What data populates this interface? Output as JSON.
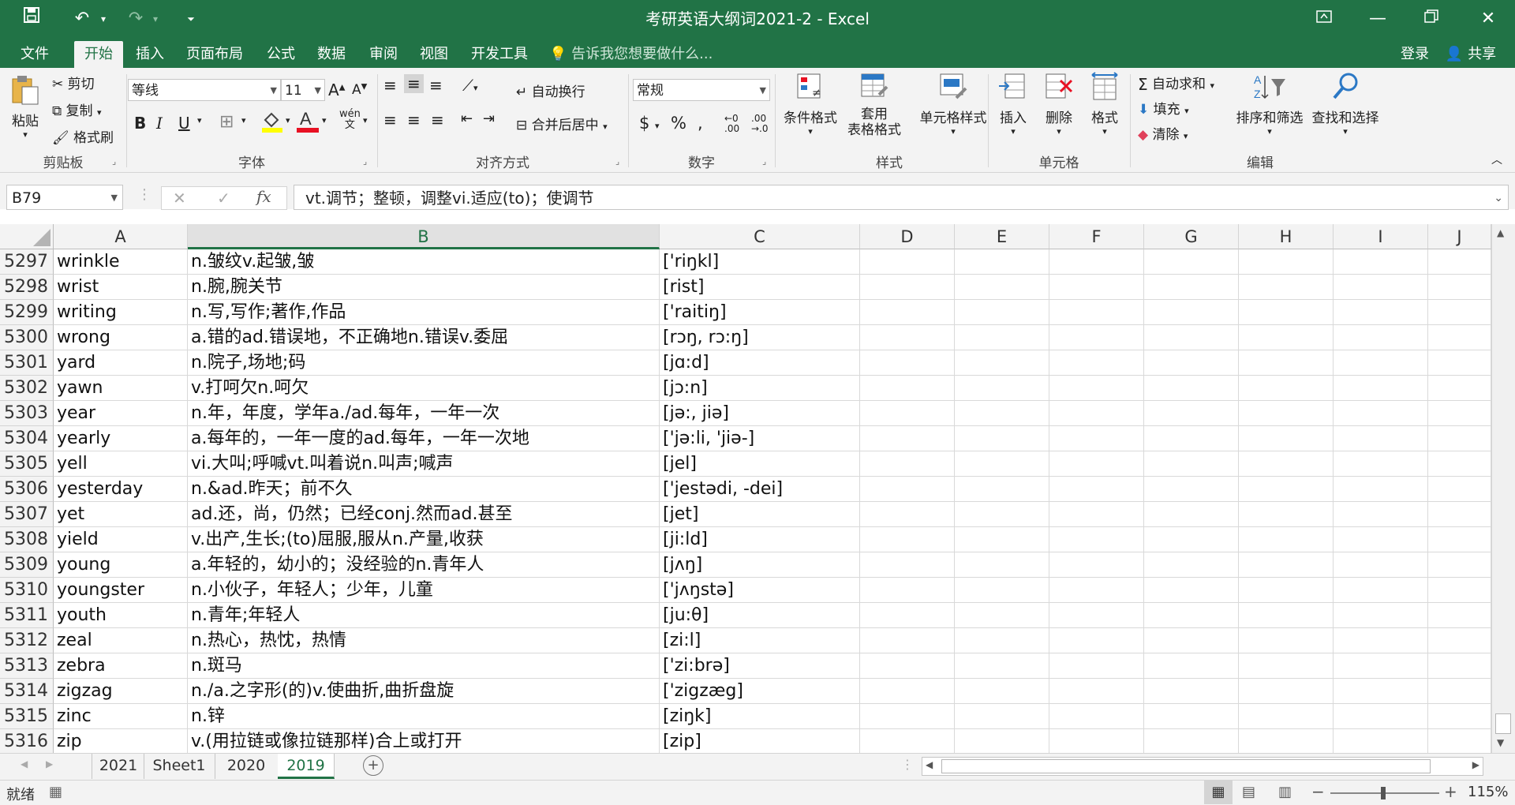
{
  "window": {
    "title": "考研英语大纲词2021-2 - Excel"
  },
  "tabs": [
    "文件",
    "开始",
    "插入",
    "页面布局",
    "公式",
    "数据",
    "审阅",
    "视图",
    "开发工具"
  ],
  "tell_me": "告诉我您想要做什么...",
  "account": {
    "login": "登录",
    "share": "共享"
  },
  "ribbon": {
    "clipboard": {
      "paste": "粘贴",
      "cut": "剪切",
      "copy": "复制",
      "format_painter": "格式刷",
      "label": "剪贴板"
    },
    "font": {
      "name": "等线",
      "size": "11",
      "label": "字体"
    },
    "alignment": {
      "wrap": "自动换行",
      "merge": "合并后居中",
      "label": "对齐方式"
    },
    "number": {
      "format": "常规",
      "label": "数字"
    },
    "styles": {
      "conditional": "条件格式",
      "table1": "套用",
      "table2": "表格格式",
      "cell_styles": "单元格样式",
      "label": "样式"
    },
    "cells": {
      "insert": "插入",
      "delete": "删除",
      "format": "格式",
      "label": "单元格"
    },
    "editing": {
      "autosum": "自动求和",
      "fill": "填充",
      "clear": "清除",
      "sort": "排序和筛选",
      "find": "查找和选择",
      "label": "编辑"
    }
  },
  "formula_bar": {
    "name_box": "B79",
    "formula": "vt.调节；整顿，调整vi.适应(to)；使调节"
  },
  "columns": [
    "A",
    "B",
    "C",
    "D",
    "E",
    "F",
    "G",
    "H",
    "I",
    "J"
  ],
  "rows": [
    {
      "n": "5297",
      "a": "wrinkle",
      "b": "n.皱纹v.起皱,皱",
      "c": "['riŋkl]"
    },
    {
      "n": "5298",
      "a": "wrist",
      "b": "n.腕,腕关节",
      "c": "[rist]"
    },
    {
      "n": "5299",
      "a": "writing",
      "b": "n.写,写作;著作,作品",
      "c": "['raitiŋ]"
    },
    {
      "n": "5300",
      "a": "wrong",
      "b": "a.错的ad.错误地，不正确地n.错误v.委屈",
      "c": "[rɔŋ, rɔ:ŋ]"
    },
    {
      "n": "5301",
      "a": "yard",
      "b": "n.院子,场地;码",
      "c": "[jɑ:d]"
    },
    {
      "n": "5302",
      "a": "yawn",
      "b": "v.打呵欠n.呵欠",
      "c": "[jɔ:n]"
    },
    {
      "n": "5303",
      "a": "year",
      "b": "n.年，年度，学年a./ad.每年，一年一次",
      "c": "[jə:, jiə]"
    },
    {
      "n": "5304",
      "a": "yearly",
      "b": "a.每年的，一年一度的ad.每年，一年一次地",
      "c": "['jə:li, 'jiə-]"
    },
    {
      "n": "5305",
      "a": "yell",
      "b": "vi.大叫;呼喊vt.叫着说n.叫声;喊声",
      "c": "[jel]"
    },
    {
      "n": "5306",
      "a": "yesterday",
      "b": "n.&ad.昨天；前不久",
      "c": "['jestədi, -dei]"
    },
    {
      "n": "5307",
      "a": "yet",
      "b": "ad.还，尚，仍然；已经conj.然而ad.甚至",
      "c": "[jet]"
    },
    {
      "n": "5308",
      "a": "yield",
      "b": "v.出产,生长;(to)屈服,服从n.产量,收获",
      "c": "[ji:ld]"
    },
    {
      "n": "5309",
      "a": "young",
      "b": "a.年轻的，幼小的；没经验的n.青年人",
      "c": "[jʌŋ]"
    },
    {
      "n": "5310",
      "a": "youngster",
      "b": "n.小伙子，年轻人；少年，儿童",
      "c": "['jʌŋstə]"
    },
    {
      "n": "5311",
      "a": "youth",
      "b": "n.青年;年轻人",
      "c": "[ju:θ]"
    },
    {
      "n": "5312",
      "a": "zeal",
      "b": "n.热心，热忱，热情",
      "c": "[zi:l]"
    },
    {
      "n": "5313",
      "a": "zebra",
      "b": "n.斑马",
      "c": "['zi:brə]"
    },
    {
      "n": "5314",
      "a": "zigzag",
      "b": "n./a.之字形(的)v.使曲折,曲折盘旋",
      "c": "['zigzæg]"
    },
    {
      "n": "5315",
      "a": "zinc",
      "b": "n.锌",
      "c": "[ziŋk]"
    },
    {
      "n": "5316",
      "a": "zip",
      "b": "v.(用拉链或像拉链那样)合上或打开",
      "c": "[zip]"
    }
  ],
  "sheets": [
    "2021",
    "Sheet1",
    "2020",
    "2019"
  ],
  "active_sheet": "2019",
  "status": {
    "ready": "就绪",
    "zoom": "115%"
  },
  "colors": {
    "accent": "#217346"
  }
}
